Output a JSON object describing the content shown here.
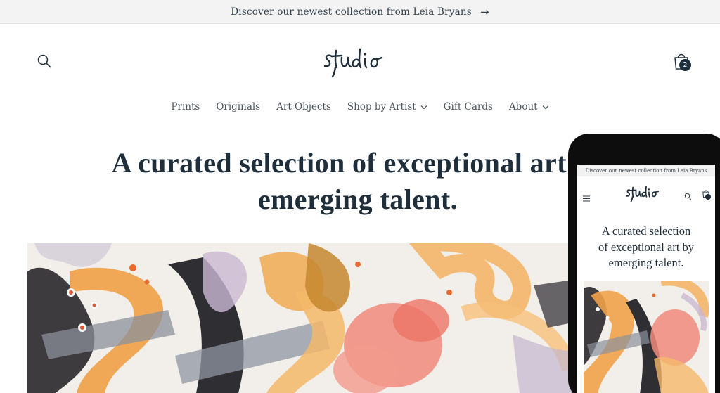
{
  "announcement": {
    "text": "Discover our newest collection from Leia Bryans",
    "icon": "arrow-right-icon"
  },
  "header": {
    "logo_text": "studio",
    "search_icon": "search-icon",
    "cart_icon": "cart-icon",
    "cart_count": "2"
  },
  "nav": {
    "items": [
      {
        "label": "Prints",
        "dropdown": false
      },
      {
        "label": "Originals",
        "dropdown": false
      },
      {
        "label": "Art Objects",
        "dropdown": false
      },
      {
        "label": "Shop by Artist",
        "dropdown": true
      },
      {
        "label": "Gift Cards",
        "dropdown": false
      },
      {
        "label": "About",
        "dropdown": true
      }
    ]
  },
  "hero": {
    "title_line1": "A curated selection of exceptional art by",
    "title_line2": "emerging talent."
  },
  "mobile": {
    "announcement": "Discover our newest collection from Leia Bryans",
    "logo_text": "studio",
    "title_line1": "A curated selection",
    "title_line2": "of exceptional art by",
    "title_line3": "emerging talent.",
    "cart_count": "2"
  },
  "colors": {
    "text": "#1f2e3b",
    "announcement_bg": "#f3f3f3",
    "badge": "#1e2e3a",
    "phone_frame": "#0d0d0d"
  }
}
